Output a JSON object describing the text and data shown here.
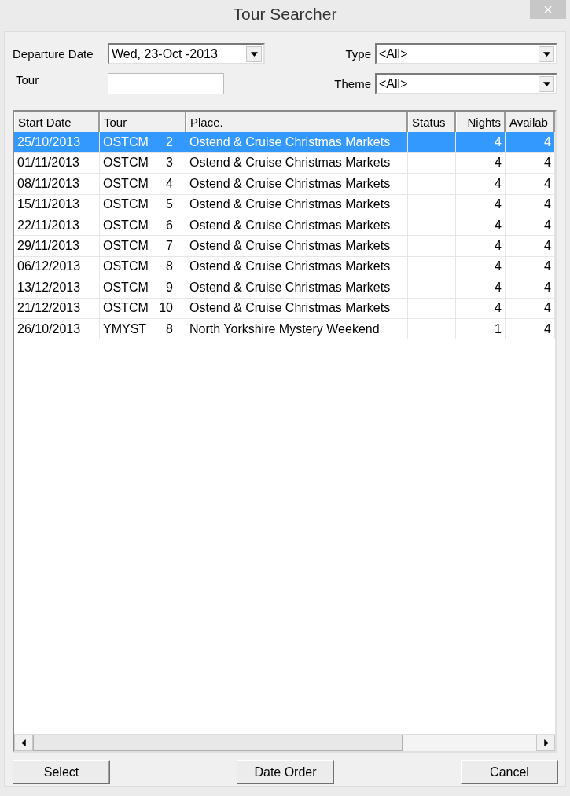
{
  "window": {
    "title": "Tour Searcher",
    "close_label": "×"
  },
  "filters": {
    "departure_date": {
      "label": "Departure Date",
      "value": "Wed, 23-Oct -2013"
    },
    "tour": {
      "label": "Tour"
    },
    "type": {
      "label": "Type",
      "value": "<All>"
    },
    "theme": {
      "label": "Theme",
      "value": "<All>"
    }
  },
  "table": {
    "columns": [
      "Start Date",
      "Tour",
      "Place.",
      "Status",
      "Nights",
      "Availab"
    ],
    "rows": [
      {
        "start_date": "25/10/2013",
        "tour_code": "OSTCM",
        "tour_number": "2",
        "place": "Ostend & Cruise Christmas Markets",
        "nights": "4",
        "column_6": "4",
        "selected": true
      },
      {
        "start_date": "01/11/2013",
        "tour_code": "OSTCM",
        "tour_number": "3",
        "place": "Ostend & Cruise Christmas Markets",
        "nights": "4",
        "column_6": "4",
        "selected": false
      },
      {
        "start_date": "08/11/2013",
        "tour_code": "OSTCM",
        "tour_number": "4",
        "place": "Ostend & Cruise Christmas Markets",
        "nights": "4",
        "column_6": "4",
        "selected": false
      },
      {
        "start_date": "15/11/2013",
        "tour_code": "OSTCM",
        "tour_number": "5",
        "place": "Ostend & Cruise Christmas Markets",
        "nights": "4",
        "column_6": "4",
        "selected": false
      },
      {
        "start_date": "22/11/2013",
        "tour_code": "OSTCM",
        "tour_number": "6",
        "place": "Ostend & Cruise Christmas Markets",
        "nights": "4",
        "column_6": "4",
        "selected": false
      },
      {
        "start_date": "29/11/2013",
        "tour_code": "OSTCM",
        "tour_number": "7",
        "place": "Ostend & Cruise Christmas Markets",
        "nights": "4",
        "column_6": "4",
        "selected": false
      },
      {
        "start_date": "06/12/2013",
        "tour_code": "OSTCM",
        "tour_number": "8",
        "place": "Ostend & Cruise Christmas Markets",
        "nights": "4",
        "column_6": "4",
        "selected": false
      },
      {
        "start_date": "13/12/2013",
        "tour_code": "OSTCM",
        "tour_number": "9",
        "place": "Ostend & Cruise Christmas Markets",
        "nights": "4",
        "column_6": "4",
        "selected": false
      },
      {
        "start_date": "21/12/2013",
        "tour_code": "OSTCM",
        "tour_number": "10",
        "place": "Ostend & Cruise Christmas Markets",
        "nights": "4",
        "column_6": "4",
        "selected": false
      },
      {
        "start_date": "26/10/2013",
        "tour_code": "YMYST",
        "tour_number": "8",
        "place": "North Yorkshire Mystery Weekend",
        "nights": "1",
        "column_6": "4",
        "selected": false
      }
    ]
  },
  "buttons": [
    "Select",
    "Date Order",
    "Cancel"
  ]
}
